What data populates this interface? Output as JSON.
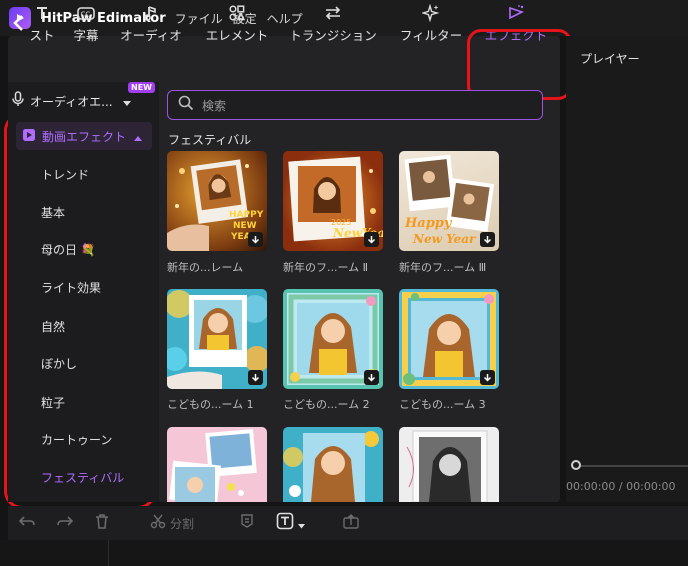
{
  "app": {
    "title": "HitPaw Edimakor"
  },
  "menu": [
    "ファイル",
    "設定",
    "ヘルプ"
  ],
  "toolbar": {
    "items": [
      {
        "label": "スト",
        "icon": "text-icon"
      },
      {
        "label": "字幕",
        "icon": "subtitle-icon"
      },
      {
        "label": "オーディオ",
        "icon": "music-note-icon"
      },
      {
        "label": "エレメント",
        "icon": "elements-icon"
      },
      {
        "label": "トランジション",
        "icon": "transition-icon"
      },
      {
        "label": "フィルター",
        "icon": "sparkle-icon"
      },
      {
        "label": "エフェクト",
        "icon": "effect-icon",
        "active": true
      }
    ]
  },
  "sidebar": {
    "audio_effects": {
      "label": "オーディオエ...",
      "badge": "NEW"
    },
    "video_effects": {
      "label": "動画エフェクト"
    },
    "categories": [
      "トレンド",
      "基本",
      "母の日 💐",
      "ライト効果",
      "自然",
      "ぼかし",
      "粒子",
      "カートゥーン",
      "フェスティバル"
    ],
    "selected": "フェスティバル"
  },
  "search": {
    "placeholder": "検索"
  },
  "section": {
    "title": "フェスティバル"
  },
  "thumbnails": [
    {
      "label": "新年の...レーム"
    },
    {
      "label": "新年のフ...ーム Ⅱ"
    },
    {
      "label": "新年のフ...ーム Ⅲ"
    },
    {
      "label": "こどもの...ーム 1"
    },
    {
      "label": "こどもの...ーム 2"
    },
    {
      "label": "こどもの...ーム 3"
    }
  ],
  "player": {
    "title": "プレイヤー",
    "time_current": "00:00:00",
    "time_separator": "/",
    "time_total": "00:00:00"
  },
  "editbar": {
    "split_label": "分割"
  },
  "colors": {
    "accent": "#b06cff",
    "highlight": "#e5141b",
    "search_border": "#9a55e0"
  }
}
